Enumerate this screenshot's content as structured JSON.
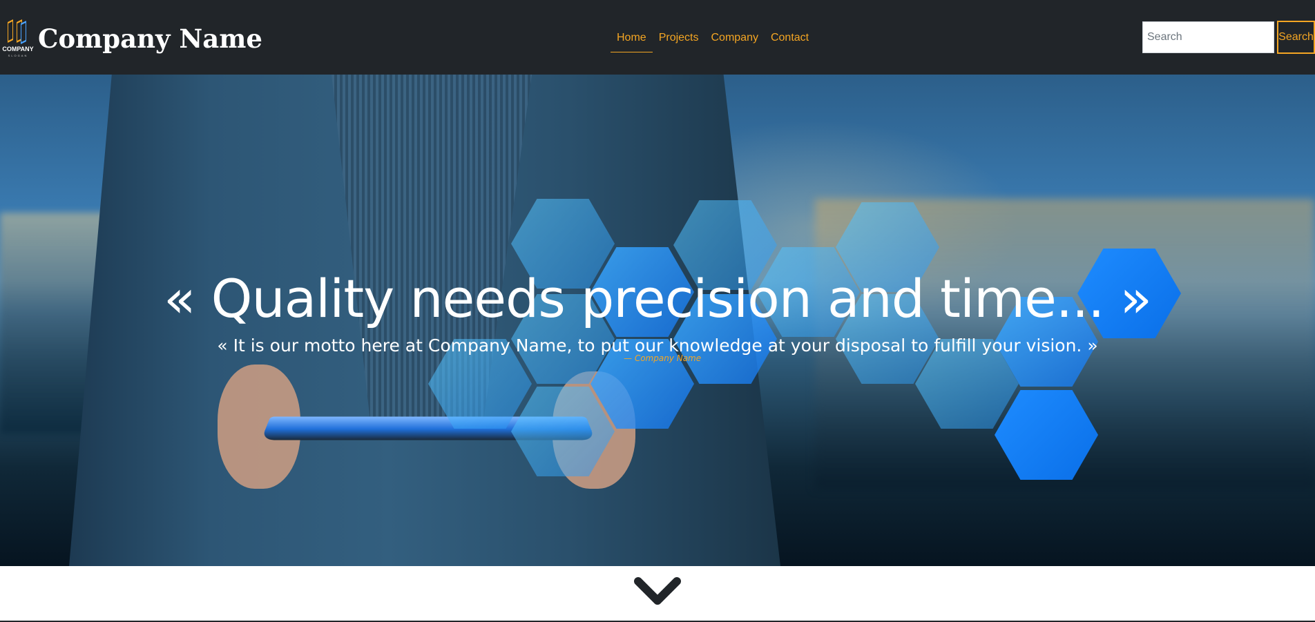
{
  "header": {
    "brand_name": "Company Name",
    "logo": {
      "icon": "company-logo-icon",
      "text": "COMPANY",
      "slogan": "SLOGAN"
    },
    "nav": [
      {
        "label": "Home",
        "active": true
      },
      {
        "label": "Projects",
        "active": false
      },
      {
        "label": "Company",
        "active": false
      },
      {
        "label": "Contact",
        "active": false
      }
    ],
    "search": {
      "placeholder": "Search",
      "value": "",
      "button_label": "Search"
    }
  },
  "hero": {
    "title": "« Quality needs precision and time... »",
    "subtitle": "« It is our motto here at Company Name, to put our knowledge at your disposal to fulfill your vision. »",
    "author": "— Company Name"
  },
  "scroll": {
    "icon": "chevron-down-icon"
  },
  "colors": {
    "navbar_bg": "#212529",
    "accent": "#f5a623",
    "hex_blue": "#1e8cff"
  }
}
